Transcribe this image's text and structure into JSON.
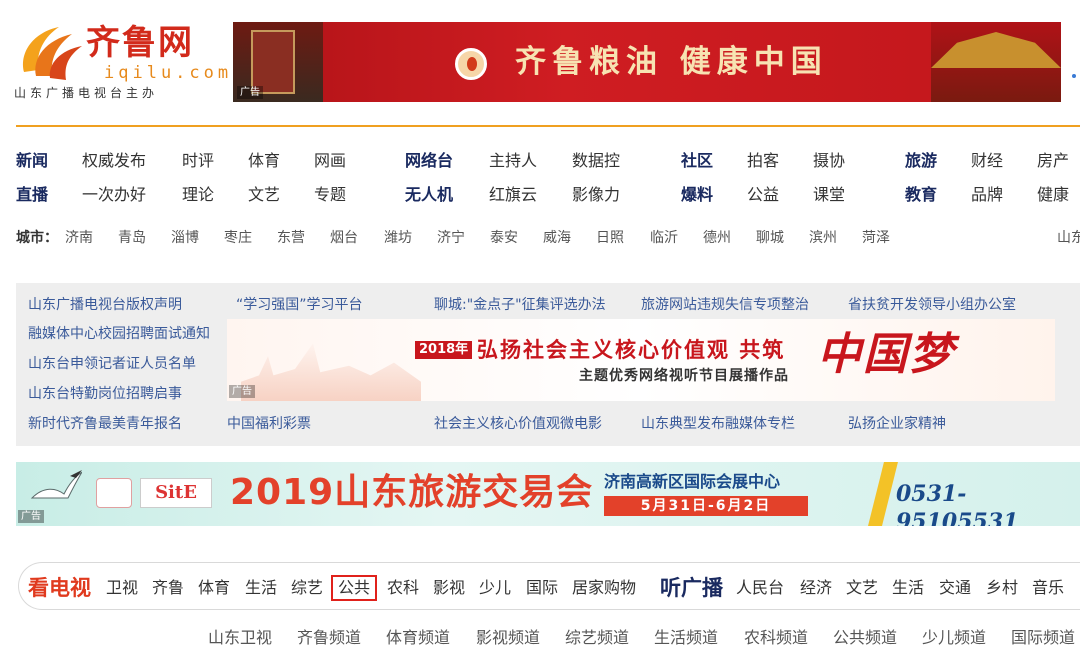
{
  "header": {
    "logo_name": "齐鲁网",
    "logo_domain": "iqilu.com",
    "logo_sub": "山东广播电视台主办",
    "top_banner_text": "齐鲁粮油 健康中国",
    "ad_label": "广告"
  },
  "nav": {
    "row1": [
      "新闻",
      "权威发布",
      "时评",
      "体育",
      "网画",
      "网络台",
      "主持人",
      "数据控",
      "社区",
      "拍客",
      "摄协",
      "旅游",
      "财经",
      "房产"
    ],
    "row2": [
      "直播",
      "一次办好",
      "理论",
      "文艺",
      "专题",
      "无人机",
      "红旗云",
      "影像力",
      "爆料",
      "公益",
      "课堂",
      "教育",
      "品牌",
      "健康"
    ]
  },
  "city": {
    "label": "城市：",
    "items": [
      "济南",
      "青岛",
      "淄博",
      "枣庄",
      "东营",
      "烟台",
      "潍坊",
      "济宁",
      "泰安",
      "威海",
      "日照",
      "临沂",
      "德州",
      "聊城",
      "滨州",
      "菏泽"
    ],
    "right_text": "山东"
  },
  "graybox": {
    "top_links": [
      "山东广播电视台版权声明",
      "“学习强国”学习平台",
      "聊城:\"金点子\"征集评选办法",
      "旅游网站违规失信专项整治",
      "省扶贫开发领导小组办公室"
    ],
    "left_links": [
      "融媒体中心校园招聘面试通知",
      "山东台申领记者证人员名单",
      "山东台特勤岗位招聘启事"
    ],
    "bottom_links": [
      "新时代齐鲁最美青年报名",
      "中国福利彩票",
      "社会主义核心价值观微电影",
      "山东典型发布融媒体专栏",
      "弘扬企业家精神"
    ],
    "banner_year": "2018年",
    "banner_title": "弘扬社会主义核心价值观 共筑",
    "banner_sub": "主题优秀网络视听节目展播作品",
    "banner_dream": "中国梦",
    "ad_label": "广告"
  },
  "tourism_banner": {
    "title": "2019山东旅游交易会",
    "venue": "济南高新区国际会展中心",
    "date": "5月31日-6月2日",
    "phone": "0531-95105531",
    "ad_label": "广告",
    "logo_text": "SitE"
  },
  "tv_bar": {
    "tv_head": "看电视",
    "tv_items": [
      "卫视",
      "齐鲁",
      "体育",
      "生活",
      "综艺",
      "公共",
      "农科",
      "影视",
      "少儿",
      "国际",
      "居家购物"
    ],
    "selected": "公共",
    "radio_head": "听广播",
    "radio_items": [
      "人民台",
      "经济",
      "文艺",
      "生活",
      "交通",
      "乡村",
      "音乐"
    ]
  },
  "channels": [
    "山东卫视",
    "齐鲁频道",
    "体育频道",
    "影视频道",
    "综艺频道",
    "生活频道",
    "农科频道",
    "公共频道",
    "少儿频道",
    "国际频道"
  ],
  "colors": {
    "brand_red": "#d22a1b",
    "brand_orange": "#e78a1c",
    "nav_blue": "#1a3a8a",
    "link_blue": "#3a5a9a",
    "selected_outline": "#e0211b"
  }
}
